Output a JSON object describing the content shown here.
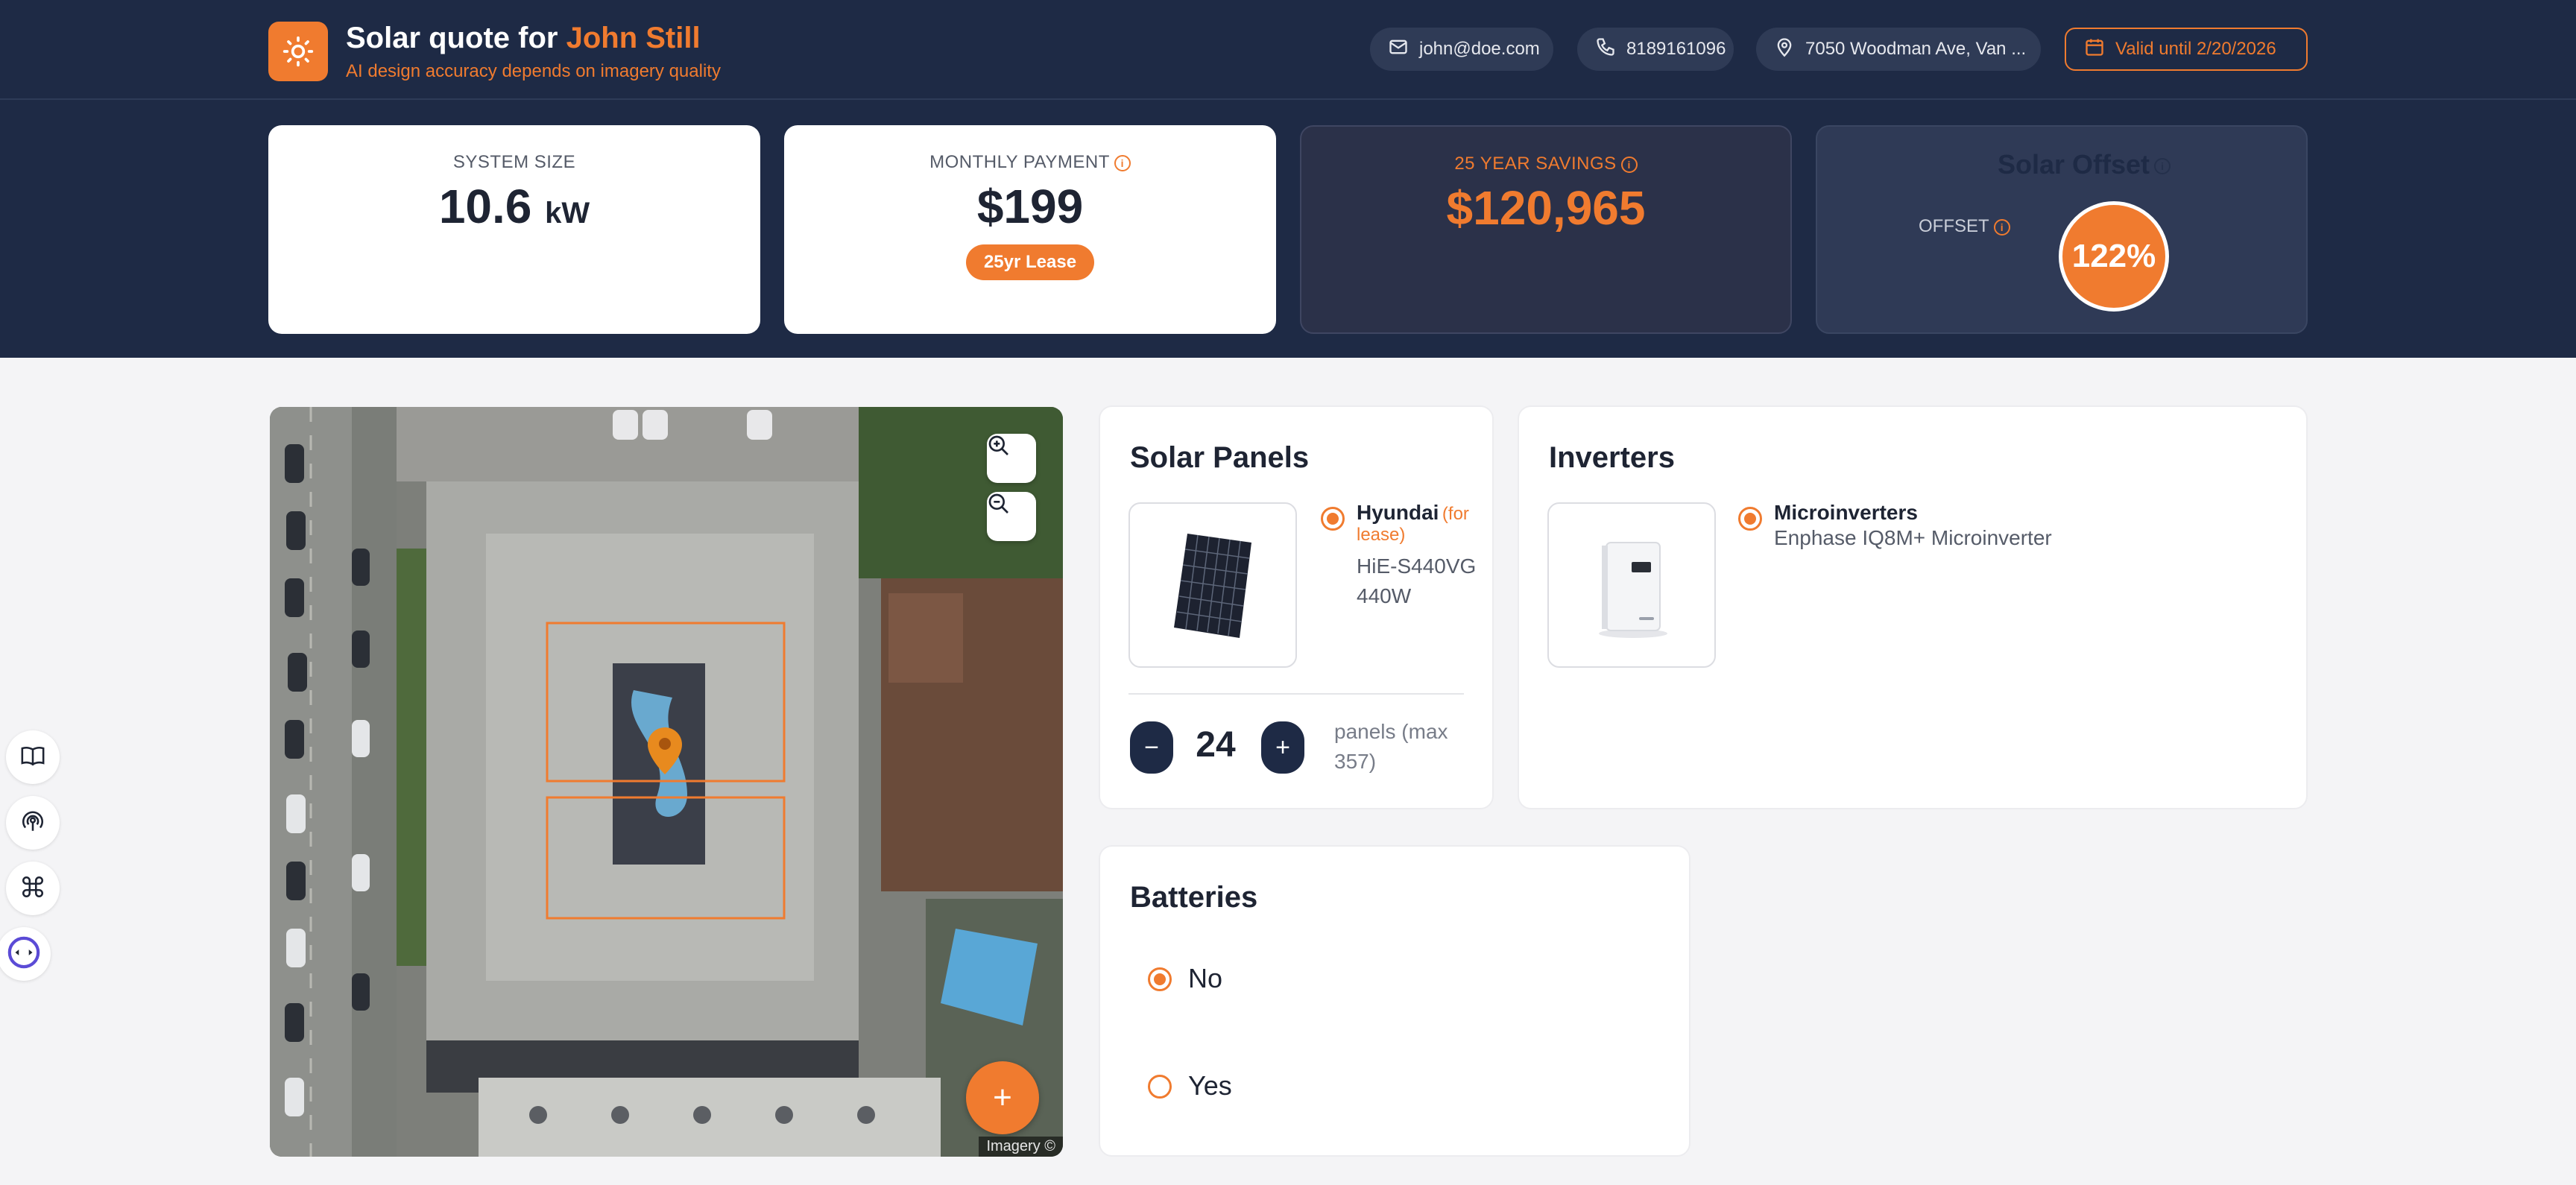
{
  "header": {
    "title_prefix": "Solar quote for",
    "customer_name": "John Still",
    "subtitle": "AI design accuracy depends on imagery quality",
    "email": "john@doe.com",
    "phone": "8189161096",
    "address": "7050 Woodman Ave, Van ...",
    "valid_until": "Valid until 2/20/2026",
    "icons": [
      "sun-icon",
      "mail-icon",
      "phone-icon",
      "map-pin-icon",
      "calendar-icon"
    ]
  },
  "stats": {
    "system_size": {
      "label": "SYSTEM SIZE",
      "value": "10.6",
      "unit": "kW"
    },
    "monthly_payment": {
      "label": "MONTHLY PAYMENT",
      "value": "$199",
      "badge": "25yr Lease"
    },
    "savings": {
      "label": "25 YEAR SAVINGS",
      "value": "$120,965"
    },
    "offset": {
      "title": "Solar Offset",
      "label": "OFFSET",
      "value": "122%"
    }
  },
  "map": {
    "attribution": "Imagery ©",
    "add_label": "+"
  },
  "solar_panels": {
    "title": "Solar Panels",
    "brand": "Hyundai",
    "tag": "(for lease)",
    "model": "HiE-S440VG 440W",
    "quantity": "24",
    "quantity_note": "panels (max 357)",
    "minus_label": "−",
    "plus_label": "+"
  },
  "inverters": {
    "title": "Inverters",
    "type": "Microinverters",
    "model": "Enphase IQ8M+ Microinverter"
  },
  "batteries": {
    "title": "Batteries",
    "options": [
      {
        "label": "No",
        "selected": true
      },
      {
        "label": "Yes",
        "selected": false
      }
    ]
  },
  "colors": {
    "accent": "#f07b2f",
    "navy": "#1e2a45",
    "background": "#f4f4f6"
  }
}
